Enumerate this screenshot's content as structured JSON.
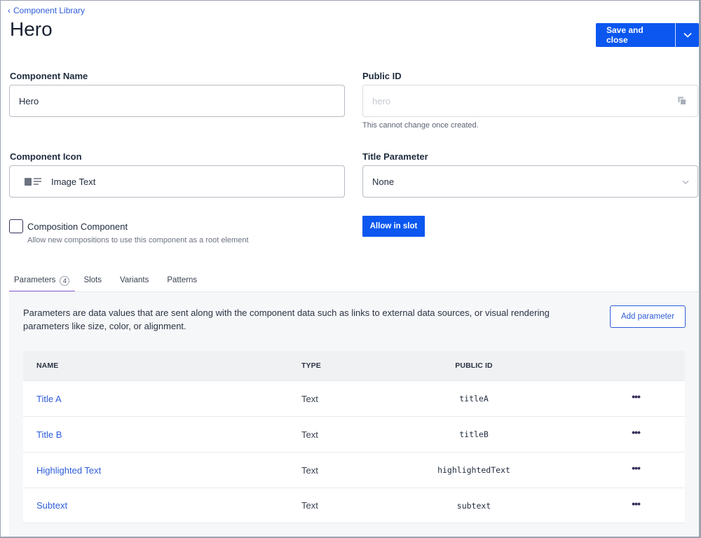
{
  "breadcrumb": {
    "label": "Component Library"
  },
  "header": {
    "title": "Hero",
    "save_label": "Save and close"
  },
  "form": {
    "component_name": {
      "label": "Component Name",
      "value": "Hero"
    },
    "public_id": {
      "label": "Public ID",
      "placeholder": "hero",
      "hint": "This cannot change once created."
    },
    "component_icon": {
      "label": "Component Icon",
      "value": "Image Text",
      "icon": "image-text-icon"
    },
    "title_parameter": {
      "label": "Title Parameter",
      "value": "None"
    },
    "composition": {
      "label": "Composition Component",
      "description": "Allow new compositions to use this component as a root element",
      "checked": false
    },
    "allow_in_slot_label": "Allow in slot"
  },
  "tabs": [
    {
      "label": "Parameters",
      "count": "4",
      "active": true
    },
    {
      "label": "Slots"
    },
    {
      "label": "Variants"
    },
    {
      "label": "Patterns"
    }
  ],
  "parameters_panel": {
    "description": "Parameters are data values that are sent along with the component data such as links to external data sources, or visual rendering parameters like size, color, or alignment.",
    "add_button_label": "Add parameter",
    "columns": {
      "name": "NAME",
      "type": "TYPE",
      "public_id": "PUBLIC ID"
    },
    "rows": [
      {
        "name": "Title A",
        "type": "Text",
        "public_id": "titleA"
      },
      {
        "name": "Title B",
        "type": "Text",
        "public_id": "titleB"
      },
      {
        "name": "Highlighted Text",
        "type": "Text",
        "public_id": "highlightedText"
      },
      {
        "name": "Subtext",
        "type": "Text",
        "public_id": "subtext"
      }
    ],
    "row_action_icon": "more-horizontal-icon"
  },
  "colors": {
    "primary": "#0b57f0",
    "link": "#2d5cd8",
    "tab_indicator": "#8a63d2",
    "panel_bg": "#f6f7f9"
  }
}
